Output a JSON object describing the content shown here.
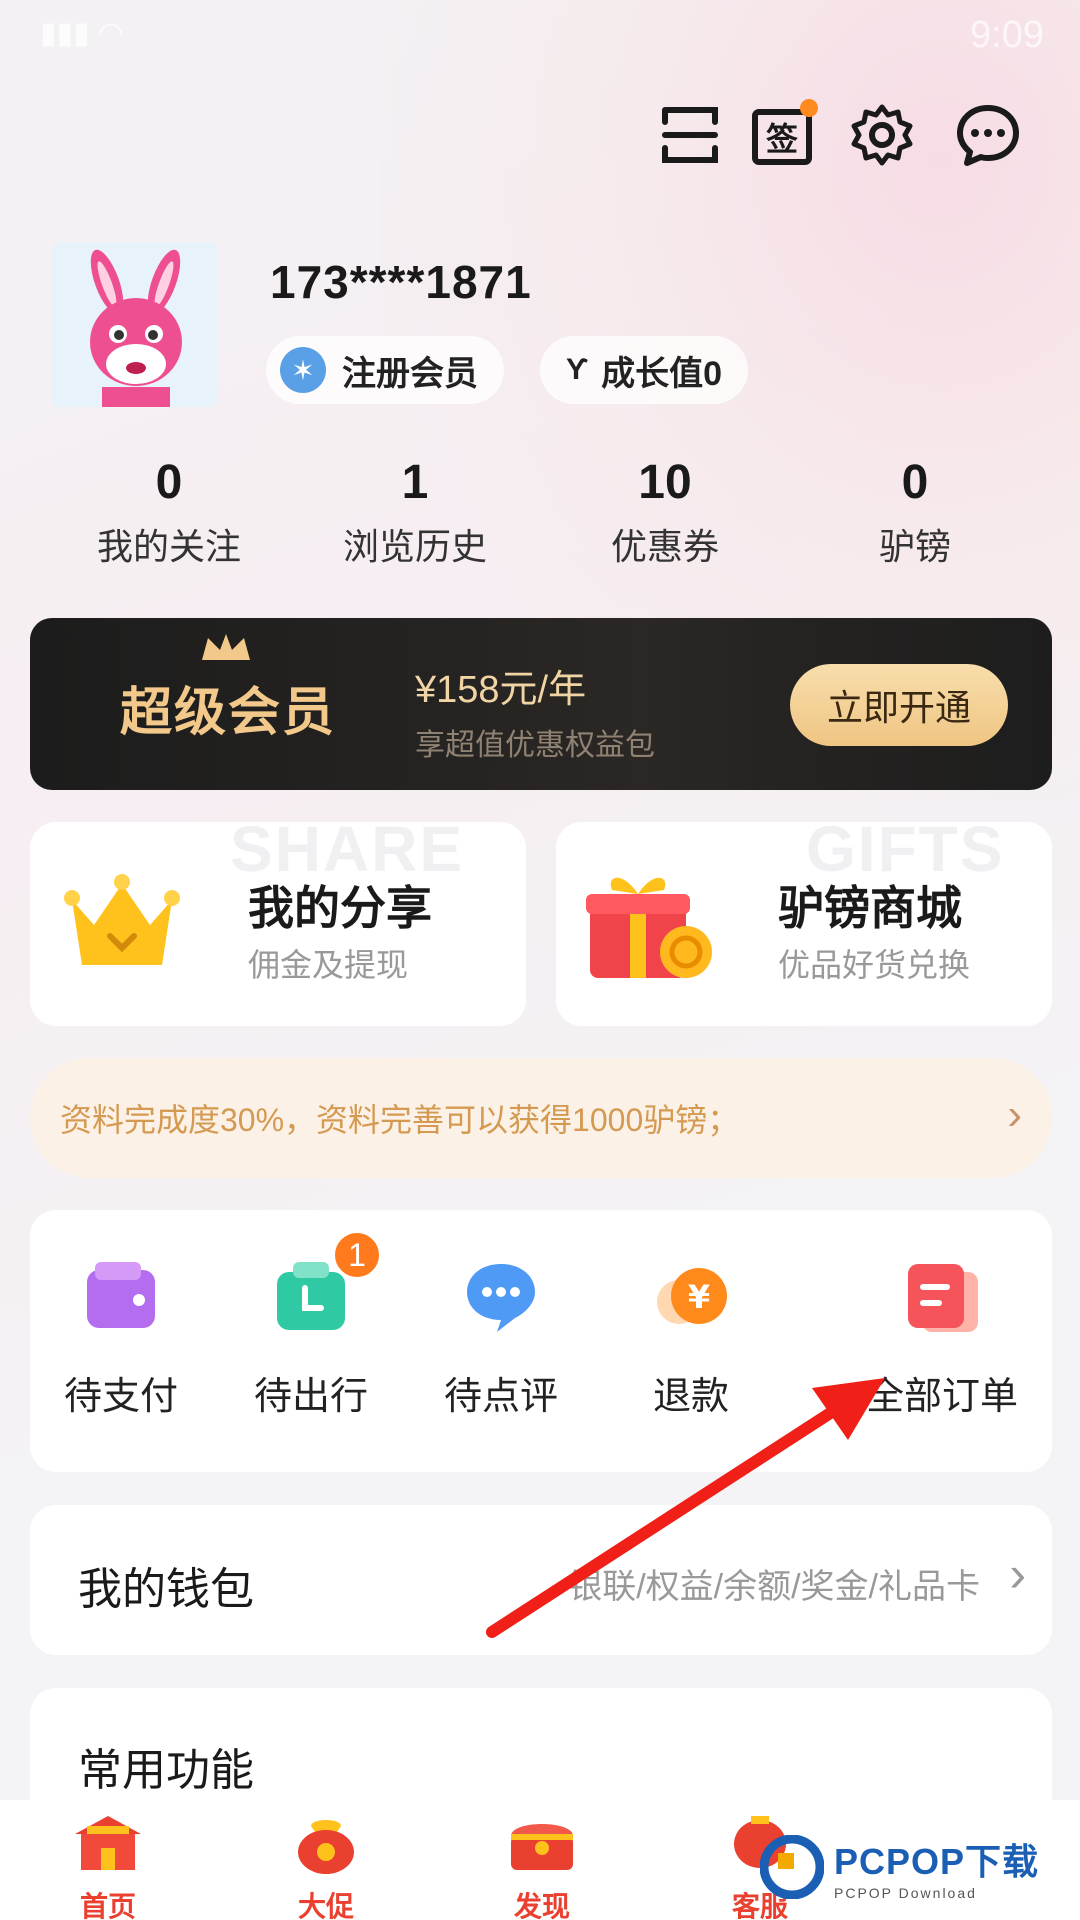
{
  "status_bar": {
    "time": "9:09"
  },
  "profile": {
    "username": "173****1871",
    "member_label": "注册会员",
    "growth_label": "成长值0"
  },
  "stats": [
    {
      "value": "0",
      "label": "我的关注"
    },
    {
      "value": "1",
      "label": "浏览历史"
    },
    {
      "value": "10",
      "label": "优惠券"
    },
    {
      "value": "0",
      "label": "驴镑"
    }
  ],
  "vip": {
    "title": "超级会员",
    "price": "¥158元/年",
    "subtitle": "享超值优惠权益包",
    "button": "立即开通"
  },
  "cards": {
    "share": {
      "watermark": "SHARE",
      "title": "我的分享",
      "subtitle": "佣金及提现"
    },
    "mall": {
      "watermark": "GIFTS",
      "title": "驴镑商城",
      "subtitle": "优品好货兑换"
    }
  },
  "completion": {
    "text": "资料完成度30%，资料完善可以获得1000驴镑；"
  },
  "orders": {
    "items": [
      {
        "label": "待支付",
        "icon": "wallet-icon"
      },
      {
        "label": "待出行",
        "icon": "suitcase-icon",
        "badge": "1"
      },
      {
        "label": "待点评",
        "icon": "chat-bubble-icon"
      },
      {
        "label": "退款",
        "icon": "refund-icon"
      },
      {
        "label": "全部订单",
        "icon": "order-list-icon"
      }
    ]
  },
  "wallet": {
    "title": "我的钱包",
    "subtitle": "银联/权益/余额/奖金/礼品卡"
  },
  "common": {
    "title": "常用功能"
  },
  "tabbar": {
    "items": [
      {
        "label": "首页"
      },
      {
        "label": "大促"
      },
      {
        "label": "发现"
      },
      {
        "label": "客服"
      }
    ]
  },
  "watermark_logo": {
    "text": "PCPOP下载",
    "sub": "PCPOP Download"
  },
  "colors": {
    "accent": "#e94030",
    "vip_gold": "#f2c98a",
    "badge": "#ff7a1c",
    "completion_text": "#d59a52"
  }
}
